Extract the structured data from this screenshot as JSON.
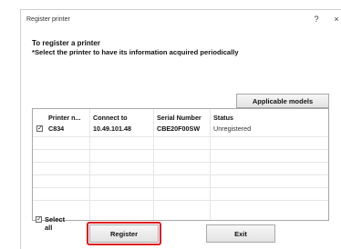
{
  "window": {
    "title": "Register printer",
    "help_glyph": "?",
    "close_glyph": "×"
  },
  "instructions": {
    "heading": "To register a printer",
    "subheading": "*Select the printer to have its information acquired periodically"
  },
  "applicable_models_label": "Applicable models",
  "table": {
    "columns": [
      "Printer n...",
      "Connect to",
      "Serial Number",
      "Status"
    ],
    "rows": [
      {
        "checked": true,
        "printer": "C834",
        "connect_to": "10.49.101.48",
        "serial": "CBE20F00SW",
        "status": "Unregistered"
      }
    ]
  },
  "select_all": {
    "label": "Select all",
    "checked": true
  },
  "buttons": {
    "register": "Register",
    "exit": "Exit"
  },
  "colors": {
    "highlight": "#e0141a"
  },
  "icons": {
    "checkbox_checked": "check-icon"
  }
}
